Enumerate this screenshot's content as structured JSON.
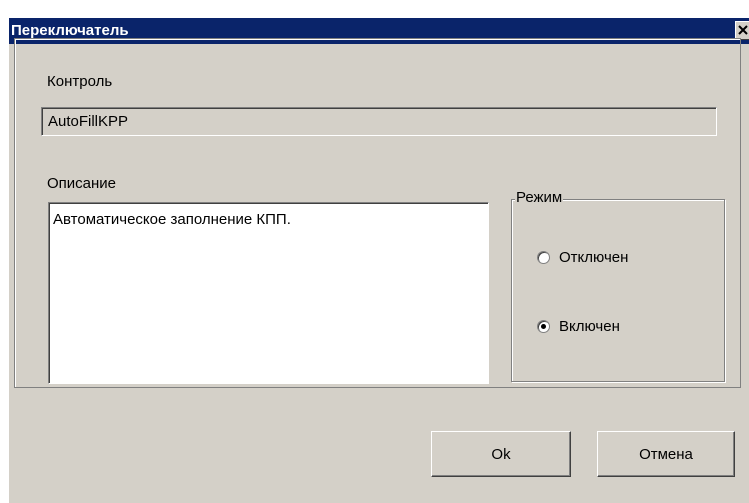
{
  "window": {
    "title": "Переключатель",
    "title_bar_color": "#0a246a",
    "background_color": "#d4d0c8",
    "close_icon": "close-icon"
  },
  "control": {
    "label": "Контроль",
    "value": "AutoFillKPP"
  },
  "description": {
    "label": "Описание",
    "text": "Автоматическое заполнение КПП."
  },
  "mode": {
    "legend": "Режим",
    "options": [
      {
        "label": "Отключен",
        "checked": false
      },
      {
        "label": "Включен",
        "checked": true
      }
    ]
  },
  "buttons": {
    "ok_label": "Ok",
    "cancel_label": "Отмена"
  }
}
